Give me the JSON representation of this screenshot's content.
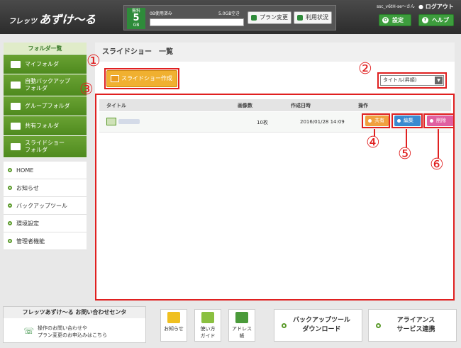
{
  "header": {
    "logo_small": "フレッツ",
    "logo_big": "あずけ〜る",
    "plan_top": "無料",
    "plan_num": "5",
    "plan_unit": "GB",
    "used": "0B使用済み",
    "free": "5.0GB空き",
    "plan_change": "プラン変更",
    "usage_status": "利用状況",
    "user": "ssc_v6tH-se〜さん",
    "logout": "ログアウト",
    "settings": "設定",
    "help": "ヘルプ"
  },
  "sidebar": {
    "title": "フォルダ一覧",
    "folders": [
      {
        "label": "マイフォルダ"
      },
      {
        "label": "自動バックアップ\nフォルダ"
      },
      {
        "label": "グループフォルダ"
      },
      {
        "label": "共有フォルダ"
      },
      {
        "label": "スライドショー\nフォルダ"
      }
    ],
    "menu": [
      {
        "label": "HOME"
      },
      {
        "label": "お知らせ"
      },
      {
        "label": "バックアップツール"
      },
      {
        "label": "環境設定"
      },
      {
        "label": "管理者機能"
      }
    ]
  },
  "main": {
    "title": "スライドショー　一覧",
    "create_button": "スライドショー作成",
    "sort_value": "タイトル(昇順)",
    "columns": {
      "title": "タイトル",
      "count": "画像数",
      "date": "作成日時",
      "action": "操作"
    },
    "rows": [
      {
        "count": "10枚",
        "date": "2016/01/28 14:09"
      }
    ],
    "share": "共有",
    "edit": "編集",
    "delete": "削除"
  },
  "annotations": [
    "①",
    "②",
    "③",
    "④",
    "⑤",
    "⑥"
  ],
  "footer": {
    "contact_title": "フレッツあずけ〜る お問い合わせセンタ",
    "contact_text1": "操作のお問い合わせや",
    "contact_text2": "プラン変更のお申込みはこちら",
    "notice": "お知らせ",
    "guide1": "使い方",
    "guide2": "ガイド",
    "address1": "アドレス",
    "address2": "帳",
    "backup1": "バックアップツール",
    "backup2": "ダウンロード",
    "alliance1": "アライアンス",
    "alliance2": "サービス連携"
  },
  "colors": {
    "accent_green": "#4e8a1e",
    "create_orange": "#f0b030",
    "annotation_red": "#e02020",
    "share": "#f0a040",
    "edit": "#3a8ad0",
    "delete": "#e060a0"
  }
}
